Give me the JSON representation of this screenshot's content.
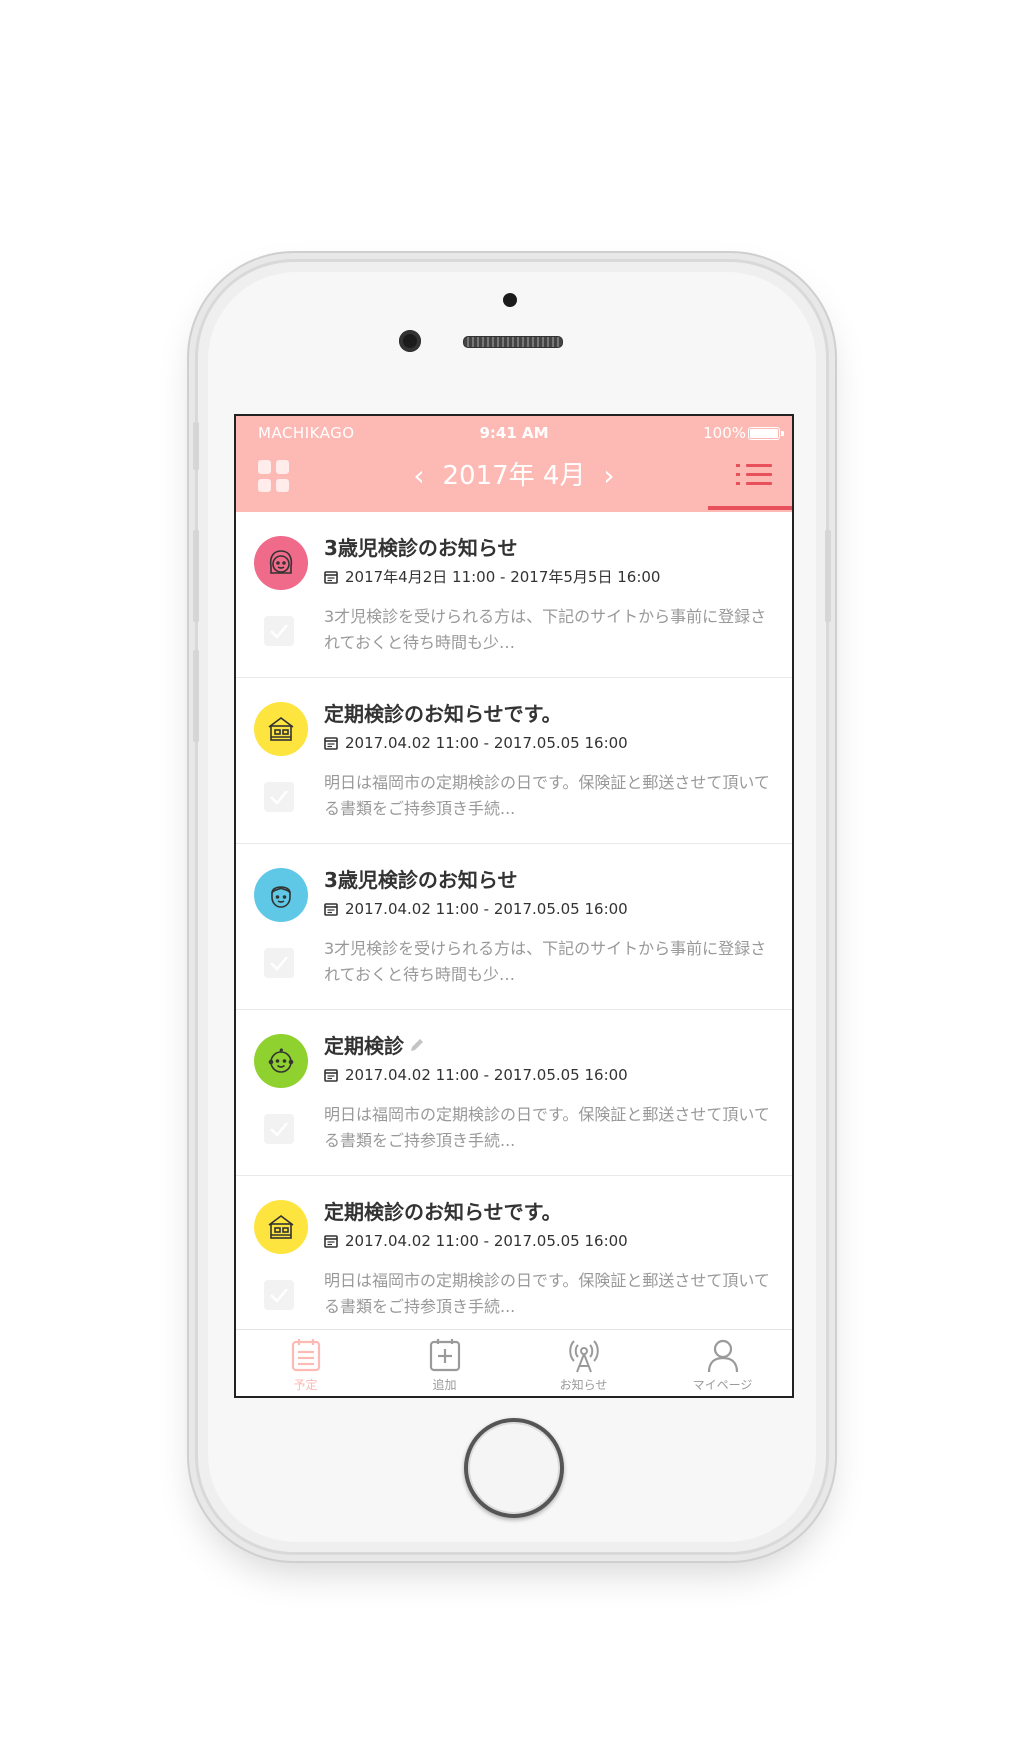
{
  "status_bar": {
    "carrier": "MACHIKAGO",
    "time": "9:41 AM",
    "battery": "100%"
  },
  "header": {
    "prev_label": "‹",
    "title": "2017年 4月",
    "next_label": "›"
  },
  "colors": {
    "header": "#fdbab5",
    "accent": "#e8515c"
  },
  "events": [
    {
      "avatar_icon": "girl-face-icon",
      "avatar_color": "#f06a8a",
      "title": "3歳児検診のお知らせ",
      "date": "2017年4月2日 11:00 - 2017年5月5日 16:00",
      "description": "3才児検診を受けられる方は、下記のサイトから事前に登録されておくと待ち時間も少…"
    },
    {
      "avatar_icon": "house-icon",
      "avatar_color": "#fde43f",
      "title": "定期検診のお知らせです。",
      "date": "2017.04.02 11:00 - 2017.05.05 16:00",
      "description": "明日は福岡市の定期検診の日です。保険証と郵送させて頂いてる書類をご持参頂き手続..."
    },
    {
      "avatar_icon": "boy-face-icon",
      "avatar_color": "#5ec8e6",
      "title": "3歳児検診のお知らせ",
      "date": "2017.04.02 11:00 - 2017.05.05 16:00",
      "description": "3才児検診を受けられる方は、下記のサイトから事前に登録されておくと待ち時間も少…"
    },
    {
      "avatar_icon": "baby-face-icon",
      "avatar_color": "#8fd12f",
      "title": "定期検診",
      "date": "2017.04.02 11:00 - 2017.05.05 16:00",
      "description": "明日は福岡市の定期検診の日です。保険証と郵送させて頂いてる書類をご持参頂き手続..."
    },
    {
      "avatar_icon": "house-icon",
      "avatar_color": "#fde43f",
      "title": "定期検診のお知らせです。",
      "date": "2017.04.02 11:00 - 2017.05.05 16:00",
      "description": "明日は福岡市の定期検診の日です。保険証と郵送させて頂いてる書類をご持参頂き手続..."
    }
  ],
  "tabs": [
    {
      "label": "予定",
      "icon": "schedule-icon",
      "active": true
    },
    {
      "label": "追加",
      "icon": "add-icon",
      "active": false
    },
    {
      "label": "お知らせ",
      "icon": "antenna-icon",
      "active": false
    },
    {
      "label": "マイページ",
      "icon": "person-icon",
      "active": false
    }
  ]
}
